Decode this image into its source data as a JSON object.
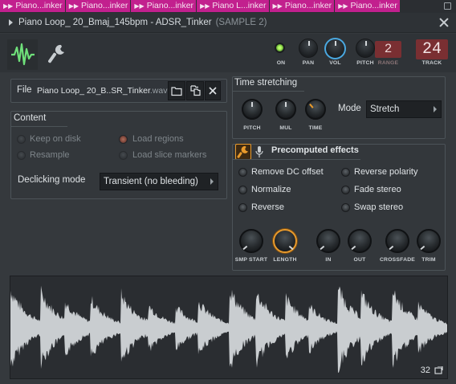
{
  "tabs": [
    "Piano...inker",
    "Piano...inker",
    "Piano...inker",
    "Piano L...inker",
    "Piano...inker",
    "Piano...inker"
  ],
  "window": {
    "title": "Piano Loop_ 20_Bmaj_145bpm - ADSR_Tinker",
    "subtitle": "(SAMPLE 2)"
  },
  "toolbar": {
    "on_label": "ON",
    "pan_label": "PAN",
    "vol_label": "VOL",
    "pitch_label": "PITCH",
    "range_label": "RANGE",
    "range_value": "2",
    "track_label": "TRACK",
    "track_value": "24"
  },
  "file": {
    "label": "File",
    "name": "Piano Loop_ 20_B..SR_Tinker",
    "ext": ".wav"
  },
  "content": {
    "title": "Content",
    "keep_on_disk": "Keep on disk",
    "resample": "Resample",
    "load_regions": "Load regions",
    "load_slice_markers": "Load slice markers",
    "declicking_label": "Declicking mode",
    "declicking_value": "Transient (no bleeding)"
  },
  "time_stretching": {
    "title": "Time stretching",
    "knobs": [
      "PITCH",
      "MUL",
      "TIME"
    ],
    "mode_label": "Mode",
    "mode_value": "Stretch"
  },
  "effects": {
    "title": "Precomputed effects",
    "options": [
      "Remove DC offset",
      "Reverse polarity",
      "Normalize",
      "Fade stereo",
      "Reverse",
      "Swap stereo"
    ],
    "knobs": [
      "SMP START",
      "LENGTH",
      "IN",
      "OUT",
      "CROSSFADE",
      "TRIM"
    ]
  },
  "waveform": {
    "zoom_value": "32"
  },
  "colors": {
    "accent_orange": "#e89a2c",
    "tab_pink": "#c2208e",
    "led_green": "#8fe04a",
    "vol_ring": "#4aa8e0"
  }
}
